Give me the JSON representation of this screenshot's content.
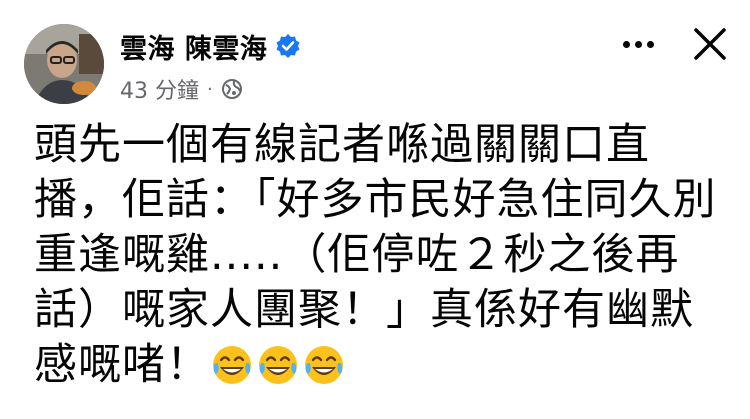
{
  "post": {
    "author": "雲海 陳雲海",
    "timestamp": "43 分鐘",
    "separator": "·",
    "body": "頭先一個有線記者喺過關關口直播，佢話：「好多市民好急住同久別重逢嘅雞.....（佢停咗２秒之後再話）嘅家人團聚！」真係好有幽默感嘅啫！",
    "emojis": [
      "joy-emoji",
      "joy-emoji",
      "joy-emoji"
    ]
  },
  "icons": {
    "verified": "verified-badge-icon",
    "audience": "globe-icon",
    "more": "more-options-icon",
    "close": "close-icon"
  },
  "colors": {
    "verified_blue": "#1877f2",
    "meta_gray": "#65676b",
    "text": "#050505"
  }
}
